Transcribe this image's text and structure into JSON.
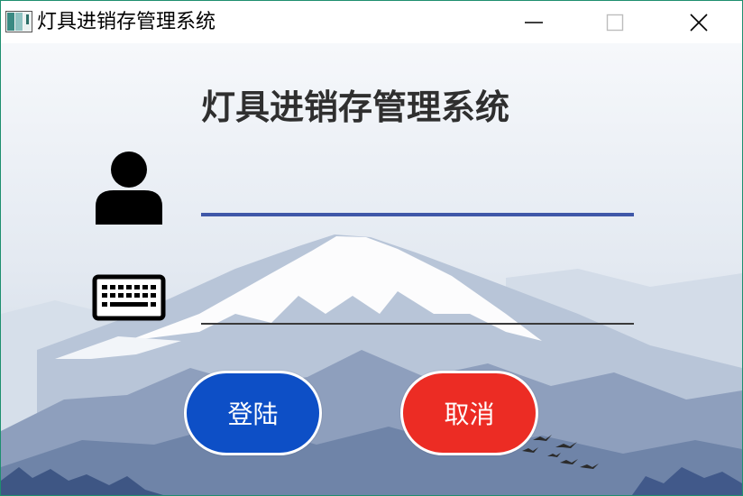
{
  "window": {
    "title": "灯具进销存管理系统",
    "controls": {
      "minimize_icon": "minimize-icon",
      "maximize_icon": "maximize-icon",
      "close_icon": "close-icon"
    }
  },
  "login": {
    "heading": "灯具进销存管理系统",
    "username": {
      "icon": "user-icon",
      "value": "",
      "placeholder": ""
    },
    "password": {
      "icon": "keyboard-icon",
      "value": "",
      "placeholder": ""
    },
    "login_button": "登陆",
    "cancel_button": "取消"
  },
  "colors": {
    "login_button": "#0d4fc6",
    "cancel_button": "#ec2c24",
    "active_underline": "#3f57a8",
    "window_border": "#1e8f6f"
  }
}
